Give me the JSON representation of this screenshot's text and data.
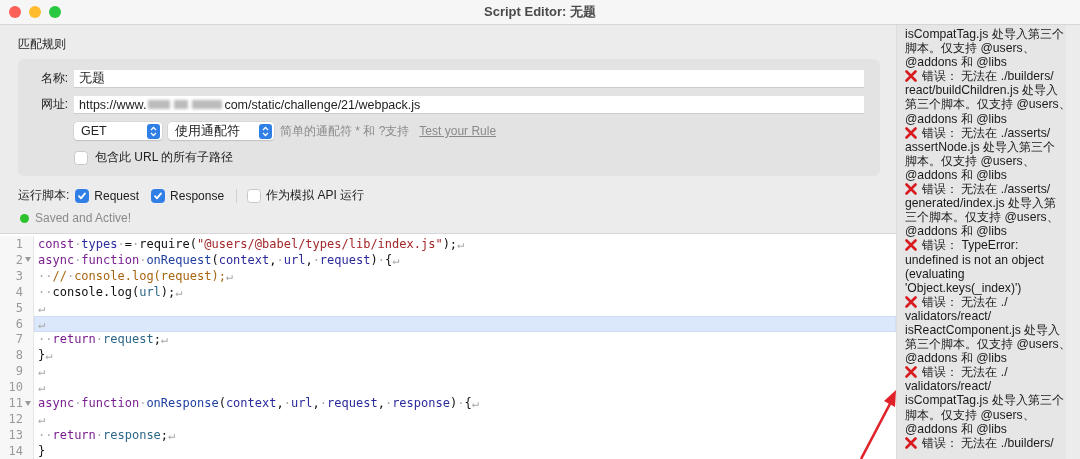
{
  "window": {
    "title": "Script Editor: 无题"
  },
  "match_rules": {
    "heading": "匹配规则",
    "name_label": "名称:",
    "name_value": "无题",
    "url_label": "网址:",
    "url_prefix": "https://www.",
    "url_suffix": "com/static/challenge/21/webpack.js",
    "method": "GET",
    "match_mode": "使用通配符",
    "hint": "简单的通配符 * 和 ?支持",
    "test_link": "Test your Rule",
    "include_subpaths": {
      "label": "包含此 URL 的所有子路径",
      "checked": false
    }
  },
  "run_script": {
    "label": "运行脚本:",
    "options": [
      {
        "label": "Request",
        "checked": true
      },
      {
        "label": "Response",
        "checked": true
      },
      {
        "label": "作为模拟 API 运行",
        "checked": false
      }
    ]
  },
  "status": {
    "text": "Saved and Active!"
  },
  "editor": {
    "lines": [
      {
        "number": "1",
        "foldable": false,
        "active": false,
        "tokens": [
          {
            "kind": "kw",
            "text": "const"
          },
          {
            "kind": "ws",
            "text": "·"
          },
          {
            "kind": "var",
            "text": "types"
          },
          {
            "kind": "ws",
            "text": "·"
          },
          {
            "kind": "plain",
            "text": "="
          },
          {
            "kind": "ws",
            "text": "·"
          },
          {
            "kind": "plain",
            "text": "require("
          },
          {
            "kind": "str",
            "text": "\"@users/@babel/types/lib/index.js\""
          },
          {
            "kind": "plain",
            "text": ");"
          },
          {
            "kind": "ws",
            "text": "↵"
          }
        ]
      },
      {
        "number": "2",
        "foldable": true,
        "active": false,
        "tokens": [
          {
            "kind": "kw",
            "text": "async"
          },
          {
            "kind": "ws",
            "text": "·"
          },
          {
            "kind": "kw",
            "text": "function"
          },
          {
            "kind": "ws",
            "text": "·"
          },
          {
            "kind": "def",
            "text": "onRequest"
          },
          {
            "kind": "plain",
            "text": "("
          },
          {
            "kind": "var",
            "text": "context"
          },
          {
            "kind": "plain",
            "text": ","
          },
          {
            "kind": "ws",
            "text": "·"
          },
          {
            "kind": "var",
            "text": "url"
          },
          {
            "kind": "plain",
            "text": ","
          },
          {
            "kind": "ws",
            "text": "·"
          },
          {
            "kind": "var",
            "text": "request"
          },
          {
            "kind": "plain",
            "text": ")"
          },
          {
            "kind": "ws",
            "text": "·"
          },
          {
            "kind": "plain",
            "text": "{"
          },
          {
            "kind": "ws",
            "text": "↵"
          }
        ]
      },
      {
        "number": "3",
        "foldable": false,
        "active": false,
        "tokens": [
          {
            "kind": "ws",
            "text": "··"
          },
          {
            "kind": "comment",
            "text": "//"
          },
          {
            "kind": "ws",
            "text": "·"
          },
          {
            "kind": "comment",
            "text": "console.log(request);"
          },
          {
            "kind": "ws",
            "text": "↵"
          }
        ]
      },
      {
        "number": "4",
        "foldable": false,
        "active": false,
        "tokens": [
          {
            "kind": "ws",
            "text": "··"
          },
          {
            "kind": "plain",
            "text": "console.log("
          },
          {
            "kind": "var2",
            "text": "url"
          },
          {
            "kind": "plain",
            "text": ");"
          },
          {
            "kind": "ws",
            "text": "↵"
          }
        ]
      },
      {
        "number": "5",
        "foldable": false,
        "active": false,
        "tokens": [
          {
            "kind": "ws",
            "text": "↵"
          }
        ]
      },
      {
        "number": "6",
        "foldable": false,
        "active": true,
        "tokens": [
          {
            "kind": "ws",
            "text": "↵"
          }
        ]
      },
      {
        "number": "7",
        "foldable": false,
        "active": false,
        "tokens": [
          {
            "kind": "ws",
            "text": "··"
          },
          {
            "kind": "kw",
            "text": "return"
          },
          {
            "kind": "ws",
            "text": "·"
          },
          {
            "kind": "var2",
            "text": "request"
          },
          {
            "kind": "plain",
            "text": ";"
          },
          {
            "kind": "ws",
            "text": "↵"
          }
        ]
      },
      {
        "number": "8",
        "foldable": false,
        "active": false,
        "tokens": [
          {
            "kind": "plain",
            "text": "}"
          },
          {
            "kind": "ws",
            "text": "↵"
          }
        ]
      },
      {
        "number": "9",
        "foldable": false,
        "active": false,
        "tokens": [
          {
            "kind": "ws",
            "text": "↵"
          }
        ]
      },
      {
        "number": "10",
        "foldable": false,
        "active": false,
        "tokens": [
          {
            "kind": "ws",
            "text": "↵"
          }
        ]
      },
      {
        "number": "11",
        "foldable": true,
        "active": false,
        "tokens": [
          {
            "kind": "kw",
            "text": "async"
          },
          {
            "kind": "ws",
            "text": "·"
          },
          {
            "kind": "kw",
            "text": "function"
          },
          {
            "kind": "ws",
            "text": "·"
          },
          {
            "kind": "def",
            "text": "onResponse"
          },
          {
            "kind": "plain",
            "text": "("
          },
          {
            "kind": "var",
            "text": "context"
          },
          {
            "kind": "plain",
            "text": ","
          },
          {
            "kind": "ws",
            "text": "·"
          },
          {
            "kind": "var",
            "text": "url"
          },
          {
            "kind": "plain",
            "text": ","
          },
          {
            "kind": "ws",
            "text": "·"
          },
          {
            "kind": "var",
            "text": "request"
          },
          {
            "kind": "plain",
            "text": ","
          },
          {
            "kind": "ws",
            "text": "·"
          },
          {
            "kind": "var",
            "text": "response"
          },
          {
            "kind": "plain",
            "text": ")"
          },
          {
            "kind": "ws",
            "text": "·"
          },
          {
            "kind": "plain",
            "text": "{"
          },
          {
            "kind": "ws",
            "text": "↵"
          }
        ]
      },
      {
        "number": "12",
        "foldable": false,
        "active": false,
        "tokens": [
          {
            "kind": "ws",
            "text": "↵"
          }
        ]
      },
      {
        "number": "13",
        "foldable": false,
        "active": false,
        "tokens": [
          {
            "kind": "ws",
            "text": "··"
          },
          {
            "kind": "kw",
            "text": "return"
          },
          {
            "kind": "ws",
            "text": "·"
          },
          {
            "kind": "var2",
            "text": "response"
          },
          {
            "kind": "plain",
            "text": ";"
          },
          {
            "kind": "ws",
            "text": "↵"
          }
        ]
      },
      {
        "number": "14",
        "foldable": false,
        "active": false,
        "tokens": [
          {
            "kind": "plain",
            "text": "}"
          }
        ]
      }
    ]
  },
  "log": {
    "lines": [
      {
        "kind": "text",
        "text": "isCompatTag.js 处导入第三个"
      },
      {
        "kind": "text",
        "text": "脚本。仅支持 @users、"
      },
      {
        "kind": "text",
        "text": "@addons 和 @libs"
      },
      {
        "kind": "error",
        "text": "错误： 无法在 ./builders/"
      },
      {
        "kind": "text",
        "text": "react/buildChildren.js 处导入"
      },
      {
        "kind": "text",
        "text": "第三个脚本。仅支持 @users、"
      },
      {
        "kind": "text",
        "text": "@addons 和 @libs"
      },
      {
        "kind": "error",
        "text": "错误： 无法在 ./asserts/"
      },
      {
        "kind": "text",
        "text": "assertNode.js 处导入第三个"
      },
      {
        "kind": "text",
        "text": "脚本。仅支持 @users、"
      },
      {
        "kind": "text",
        "text": "@addons 和 @libs"
      },
      {
        "kind": "error",
        "text": "错误： 无法在 ./asserts/"
      },
      {
        "kind": "text",
        "text": "generated/index.js 处导入第"
      },
      {
        "kind": "text",
        "text": "三个脚本。仅支持 @users、"
      },
      {
        "kind": "text",
        "text": "@addons 和 @libs"
      },
      {
        "kind": "error",
        "text": "错误： TypeError:"
      },
      {
        "kind": "text",
        "text": "undefined is not an object"
      },
      {
        "kind": "text",
        "text": "(evaluating"
      },
      {
        "kind": "text",
        "text": "'Object.keys(_index)')"
      },
      {
        "kind": "error",
        "text": "错误： 无法在 ./"
      },
      {
        "kind": "text",
        "text": "validators/react/"
      },
      {
        "kind": "text",
        "text": "isReactComponent.js 处导入"
      },
      {
        "kind": "text",
        "text": "第三个脚本。仅支持 @users、"
      },
      {
        "kind": "text",
        "text": "@addons 和 @libs"
      },
      {
        "kind": "error",
        "text": "错误： 无法在 ./"
      },
      {
        "kind": "text",
        "text": "validators/react/"
      },
      {
        "kind": "text",
        "text": "isCompatTag.js 处导入第三个"
      },
      {
        "kind": "text",
        "text": "脚本。仅支持 @users、"
      },
      {
        "kind": "text",
        "text": "@addons 和 @libs"
      },
      {
        "kind": "error",
        "text": "错误： 无法在 ./builders/"
      }
    ]
  }
}
